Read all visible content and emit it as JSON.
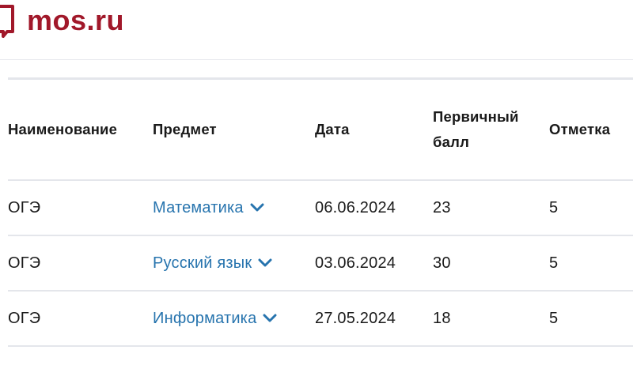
{
  "header": {
    "logo_text": "mos.ru",
    "brand_color": "#a1182a"
  },
  "table": {
    "columns": {
      "name": "Наименование",
      "subject": "Предмет",
      "date": "Дата",
      "primary_score": "Первичный балл",
      "grade": "Отметка"
    },
    "link_color": "#2774ae",
    "rows": [
      {
        "name": "ОГЭ",
        "subject": "Математика",
        "date": "06.06.2024",
        "primary_score": "23",
        "grade": "5"
      },
      {
        "name": "ОГЭ",
        "subject": "Русский язык",
        "date": "03.06.2024",
        "primary_score": "30",
        "grade": "5"
      },
      {
        "name": "ОГЭ",
        "subject": "Информатика",
        "date": "27.05.2024",
        "primary_score": "18",
        "grade": "5"
      }
    ]
  }
}
